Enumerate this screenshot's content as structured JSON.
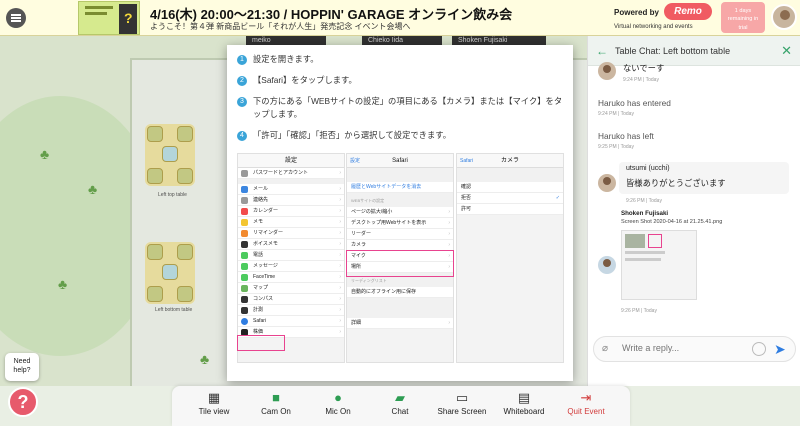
{
  "header": {
    "title": "4/16(木) 20:00〜21:30 / HOPPIN' GARAGE オンライン飲み会",
    "subtitle": "ようこそ！第４弾 新商品ビール「それが人生」発売記念 イベント会場へ",
    "powered_by": "Powered by",
    "brand": "Remo",
    "brand_tagline": "Virtual networking and events",
    "trial": "1 days remaining in trial"
  },
  "floor": {
    "cams": [
      "meiko",
      "Chieko Iida",
      "Shoken Fujisaki"
    ],
    "table_labels": [
      "Left top table",
      "Left bottom table"
    ]
  },
  "modal": {
    "steps": [
      {
        "n": "1",
        "text": "設定を開きます。"
      },
      {
        "n": "2",
        "text": "【Safari】をタップします。"
      },
      {
        "n": "3",
        "text": "下の方にある「WEBサイトの設定」の項目にある【カメラ】または【マイク】をタップします。"
      },
      {
        "n": "4",
        "text": "「許可」「確認」「拒否」から選択して設定できます。"
      }
    ],
    "settings_title": "設定",
    "settings_rows": [
      "パスワードとアカウント",
      "メール",
      "連絡先",
      "カレンダー",
      "メモ",
      "リマインダー",
      "ボイスメモ",
      "電話",
      "メッセージ",
      "FaceTime",
      "マップ",
      "コンパス",
      "計測",
      "Safari",
      "株価"
    ],
    "safari_back": "設定",
    "safari_title": "Safari",
    "safari_rows": [
      "履歴とWebサイトデータを消去",
      "WEBサイトの設定",
      "ページの拡大/縮小",
      "デスクトップ用Webサイトを表示",
      "リーダー",
      "カメラ",
      "マイク",
      "場所",
      "リーディングリスト",
      "自動的にオフライン用に保存",
      "詳細"
    ],
    "camera_back": "Safari",
    "camera_title": "カメラ",
    "camera_options": [
      "確認",
      "拒否",
      "許可"
    ]
  },
  "chat": {
    "title": "Table Chat: Left bottom table",
    "messages": [
      {
        "text": "ないでーす",
        "time": "9:24 PM | Today"
      },
      {
        "sys": "Haruko has entered",
        "time": "9:24 PM | Today"
      },
      {
        "sys": "Haruko has left",
        "time": "9:25 PM | Today"
      },
      {
        "name": "utsumi (ucchi)",
        "text": "皆様ありがとうございます",
        "time": "9:26 PM | Today"
      }
    ],
    "attachment": {
      "sender": "Shoken Fujisaki",
      "file": "Screen Shot 2020-04-16 at 21.25.41.png",
      "time": "9:26 PM | Today"
    },
    "input_placeholder": "Write a reply..."
  },
  "toolbar": {
    "items": [
      {
        "label": "Tile view",
        "icon": "grid-icon"
      },
      {
        "label": "Cam On",
        "icon": "camera-icon"
      },
      {
        "label": "Mic On",
        "icon": "mic-icon"
      },
      {
        "label": "Chat",
        "icon": "chat-icon"
      },
      {
        "label": "Share Screen",
        "icon": "screen-icon"
      },
      {
        "label": "Whiteboard",
        "icon": "whiteboard-icon"
      },
      {
        "label": "Quit Event",
        "icon": "exit-icon"
      }
    ]
  },
  "help": {
    "label": "Need help?"
  },
  "colors": {
    "accent_green": "#2e9d53",
    "quit_red": "#d23b3b",
    "remo_red": "#f05b62",
    "highlight_pink": "#e8438f"
  }
}
